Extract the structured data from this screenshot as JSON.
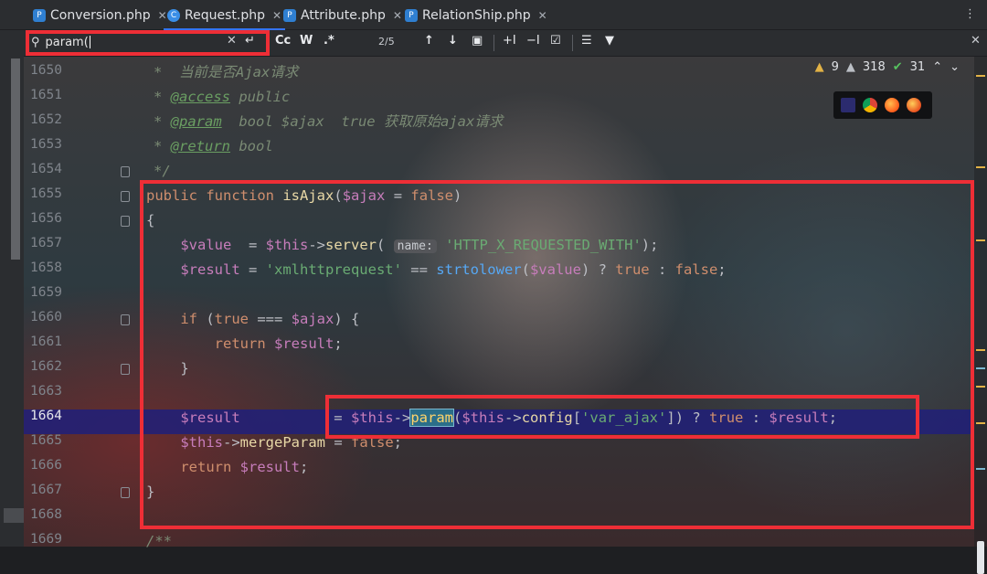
{
  "tabs": [
    {
      "label": "Conversion.php",
      "icon": "php-file-icon",
      "active": false
    },
    {
      "label": "Request.php",
      "icon": "php-class-icon",
      "active": true
    },
    {
      "label": "Attribute.php",
      "icon": "php-file-icon",
      "active": false
    },
    {
      "label": "RelationShip.php",
      "icon": "php-file-icon",
      "active": false
    }
  ],
  "tab_overflow": "⋮",
  "find": {
    "query": "param(",
    "match_case_label": "Cc",
    "words_label": "W",
    "regex_label": ".*",
    "count": "2/5"
  },
  "inspections": {
    "warnings": "9",
    "weak_warnings": "318",
    "ok": "31"
  },
  "line_numbers": [
    "1650",
    "1651",
    "1652",
    "1653",
    "1654",
    "1655",
    "1656",
    "1657",
    "1658",
    "1659",
    "1660",
    "1661",
    "1662",
    "1663",
    "1664",
    "1665",
    "1666",
    "1667",
    "1668",
    "1669"
  ],
  "current_line": "1664",
  "code": {
    "l1650": "*  当前是否Ajax请求",
    "l1651_star": "* ",
    "l1651_tag": "@access",
    "l1651_rest": " public",
    "l1652_star": "* ",
    "l1652_tag": "@param",
    "l1652_rest": "  bool $ajax  true 获取原始ajax请求",
    "l1653_star": "* ",
    "l1653_tag": "@return",
    "l1653_rest": " bool",
    "l1654": "*/",
    "kw_public": "public",
    "kw_function": "function",
    "fn_isAjax": "isAjax",
    "param_ajax": "$ajax",
    "kw_false": "false",
    "brace_open": "{",
    "var_value": "$value",
    "var_this": "$this",
    "m_server": "server",
    "hint_name": "name:",
    "str_header": "'HTTP_X_REQUESTED_WITH'",
    "var_result": "$result",
    "str_xml": "'xmlhttprequest'",
    "fn_strtolower": "strtolower",
    "kw_true": "true",
    "kw_if": "if",
    "kw_return": "return",
    "brace_close": "}",
    "m_param": "param",
    "m_config": "config",
    "str_varajax": "'var_ajax'",
    "m_merge": "mergeParam",
    "l1669": "/**"
  },
  "colors": {
    "highlight": "#212078",
    "annotation_border": "#ee2e36",
    "keyword": "#cf8e6d",
    "string": "#6aab73",
    "variable": "#c77dbb"
  }
}
